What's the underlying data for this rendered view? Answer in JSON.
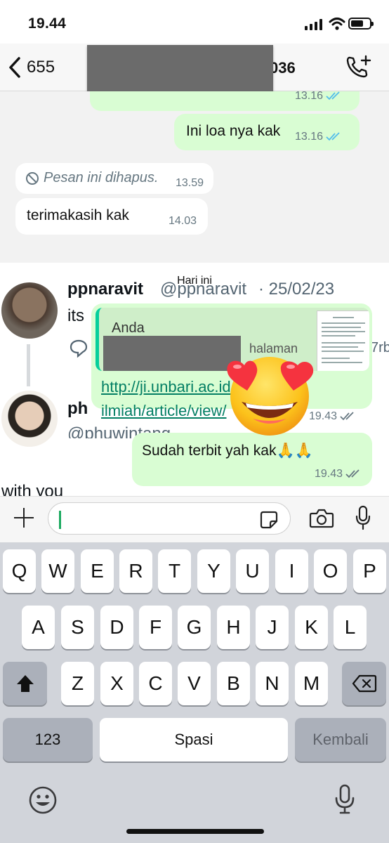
{
  "status_bar": {
    "time": "19.44"
  },
  "header": {
    "back_count": "655",
    "contact_name_suffix": "036"
  },
  "chat": {
    "messages": [
      {
        "time": "13.16"
      },
      {
        "text": "Ini loa nya kak",
        "time": "13.16"
      },
      {
        "text": "Pesan ini dihapus.",
        "time": "13.59"
      },
      {
        "text": "terimakasih kak",
        "time": "14.03"
      }
    ],
    "date_separator": "Hari ini",
    "tweet": {
      "author1_name": "ppnaravit",
      "author1_handle": "@ppnaravit",
      "author1_date": "· 25/02/23",
      "author1_text": "its",
      "partial_count": "7rb",
      "author2_name": "ph",
      "author2_handle": "@phuwintang",
      "trailing_text": "with you"
    },
    "reply": {
      "quoted_author": "Anda",
      "quoted_snippet": "halaman",
      "link_line1": "http://ji.unbari.ac.id/index.php/",
      "link_line2": "ilmiah/article/view/",
      "time": "19.43"
    },
    "last_message": {
      "text": "Sudah terbit yah kak🙏🙏",
      "time": "19.43"
    }
  },
  "input": {
    "placeholder": ""
  },
  "keyboard": {
    "row1": [
      "Q",
      "W",
      "E",
      "R",
      "T",
      "Y",
      "U",
      "I",
      "O",
      "P"
    ],
    "row2": [
      "A",
      "S",
      "D",
      "F",
      "G",
      "H",
      "J",
      "K",
      "L"
    ],
    "row3": [
      "Z",
      "X",
      "C",
      "V",
      "B",
      "N",
      "M"
    ],
    "numbers_key": "123",
    "space_key": "Spasi",
    "return_key": "Kembali"
  },
  "colors": {
    "outgoing_bubble": "#d9fdd3",
    "chat_bg": "#f2f2f2",
    "link": "#027e63",
    "read_tick": "#53bdeb"
  }
}
